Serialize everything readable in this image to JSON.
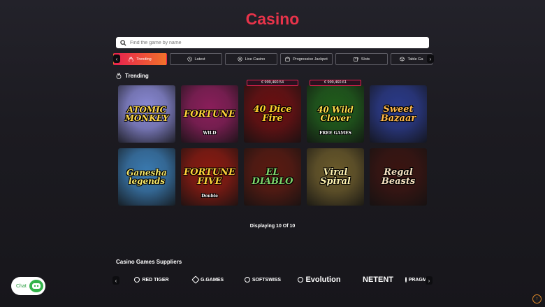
{
  "page": {
    "title": "Casino"
  },
  "search": {
    "placeholder": "Find the game by name"
  },
  "tabs": [
    {
      "label": "Trending",
      "icon": "flame-icon",
      "active": true
    },
    {
      "label": "Latest",
      "icon": "clock-icon",
      "active": false
    },
    {
      "label": "Live Casino",
      "icon": "chip-icon",
      "active": false
    },
    {
      "label": "Progressive Jackpot",
      "icon": "jackpot-icon",
      "active": false
    },
    {
      "label": "Slots",
      "icon": "slot-machine-icon",
      "active": false
    },
    {
      "label": "Table Ga",
      "icon": "cube-icon",
      "active": false
    }
  ],
  "section": {
    "title": "Trending",
    "icon": "flame-icon"
  },
  "games": [
    {
      "name": "ATOMIC MONKEY",
      "bg": "#8a8ad6",
      "color": "#ffd84a",
      "jackpot": ""
    },
    {
      "name": "FORTUNE",
      "sub": "WILD",
      "bg": "#8a1e5a",
      "color": "#ffd13a",
      "jackpot": ""
    },
    {
      "name": "40 Dice Fire",
      "bg": "#6b0f10",
      "color": "#ffcf2e",
      "jackpot": "€ 999,460.54"
    },
    {
      "name": "40 Wild Clover",
      "sub": "FREE GAMES",
      "bg": "#1f5d1a",
      "color": "#ffe04a",
      "jackpot": "€ 999,460.61"
    },
    {
      "name": "Sweet Bazaar",
      "bg": "#2a3a8a",
      "color": "#ffb84a",
      "jackpot": ""
    },
    {
      "name": "Ganesha legends",
      "bg": "#3a7ab0",
      "color": "#f7e86a",
      "jackpot": ""
    },
    {
      "name": "FORTUNE FIVE",
      "sub": "Double",
      "bg": "#8a1a10",
      "color": "#ffd13a",
      "jackpot": ""
    },
    {
      "name": "EL DIABLO",
      "bg": "#5a1a10",
      "color": "#7ed46a",
      "jackpot": ""
    },
    {
      "name": "Viral Spiral",
      "bg": "#6a5a2a",
      "color": "#fff3b0",
      "jackpot": ""
    },
    {
      "name": "Regal Beasts",
      "bg": "#3a1410",
      "color": "#f5e0c0",
      "jackpot": ""
    }
  ],
  "pagination": {
    "text": "Displaying 10 Of 10"
  },
  "suppliers": {
    "title": "Casino Games Suppliers",
    "items": [
      {
        "name": "RED TIGER",
        "icon": "tiger-icon"
      },
      {
        "name": "G.GAMES",
        "icon": "g-games-logo-icon"
      },
      {
        "name": "SOFTSWISS",
        "icon": "softswiss-logo-icon"
      },
      {
        "name": "Evolution",
        "icon": "evolution-logo-icon"
      },
      {
        "name": "NETENT",
        "icon": ""
      },
      {
        "name": "PRAGMATIC",
        "icon": "pragmatic-logo-icon"
      }
    ]
  },
  "chat": {
    "label": "Chat",
    "icon": "chat-bot-icon"
  },
  "scroll_top": {
    "icon": "arrow-up-icon"
  },
  "colors": {
    "accent": "#e8334a",
    "tab_gradient_start": "#e8204f",
    "tab_gradient_end": "#f2722a",
    "chat_green": "#33b34a"
  }
}
